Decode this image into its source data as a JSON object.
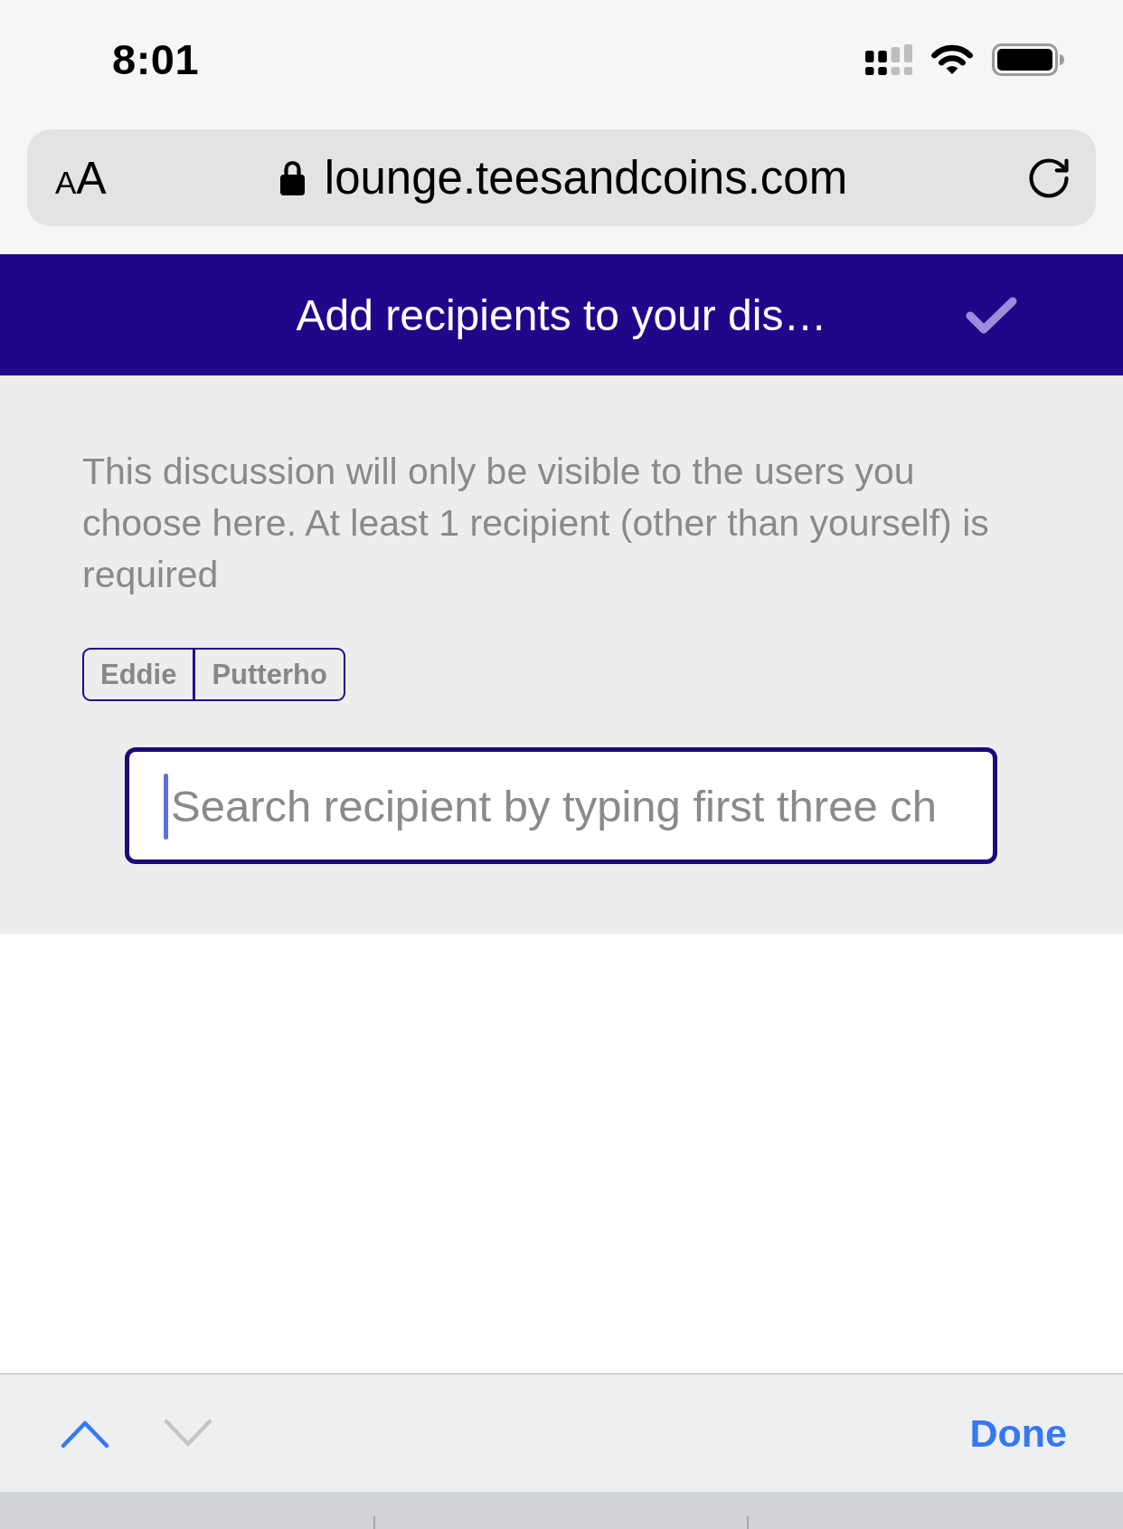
{
  "status_bar": {
    "time": "8:01"
  },
  "address_bar": {
    "text_size_button": {
      "small": "A",
      "large": "A"
    },
    "secure": true,
    "url": "lounge.teesandcoins.com"
  },
  "header": {
    "title": "Add recipients to your dis…"
  },
  "notice": "This discussion will only be visible to the users you choose here. At least 1 recipient (other than yourself) is required",
  "recipient_tags": [
    "Eddie",
    "Putterho"
  ],
  "search": {
    "placeholder": "Search recipient by typing first three ch",
    "focused": true
  },
  "keyboard_toolbar": {
    "previous": {
      "disabled": false
    },
    "next": {
      "disabled": true
    },
    "done": "Done"
  }
}
